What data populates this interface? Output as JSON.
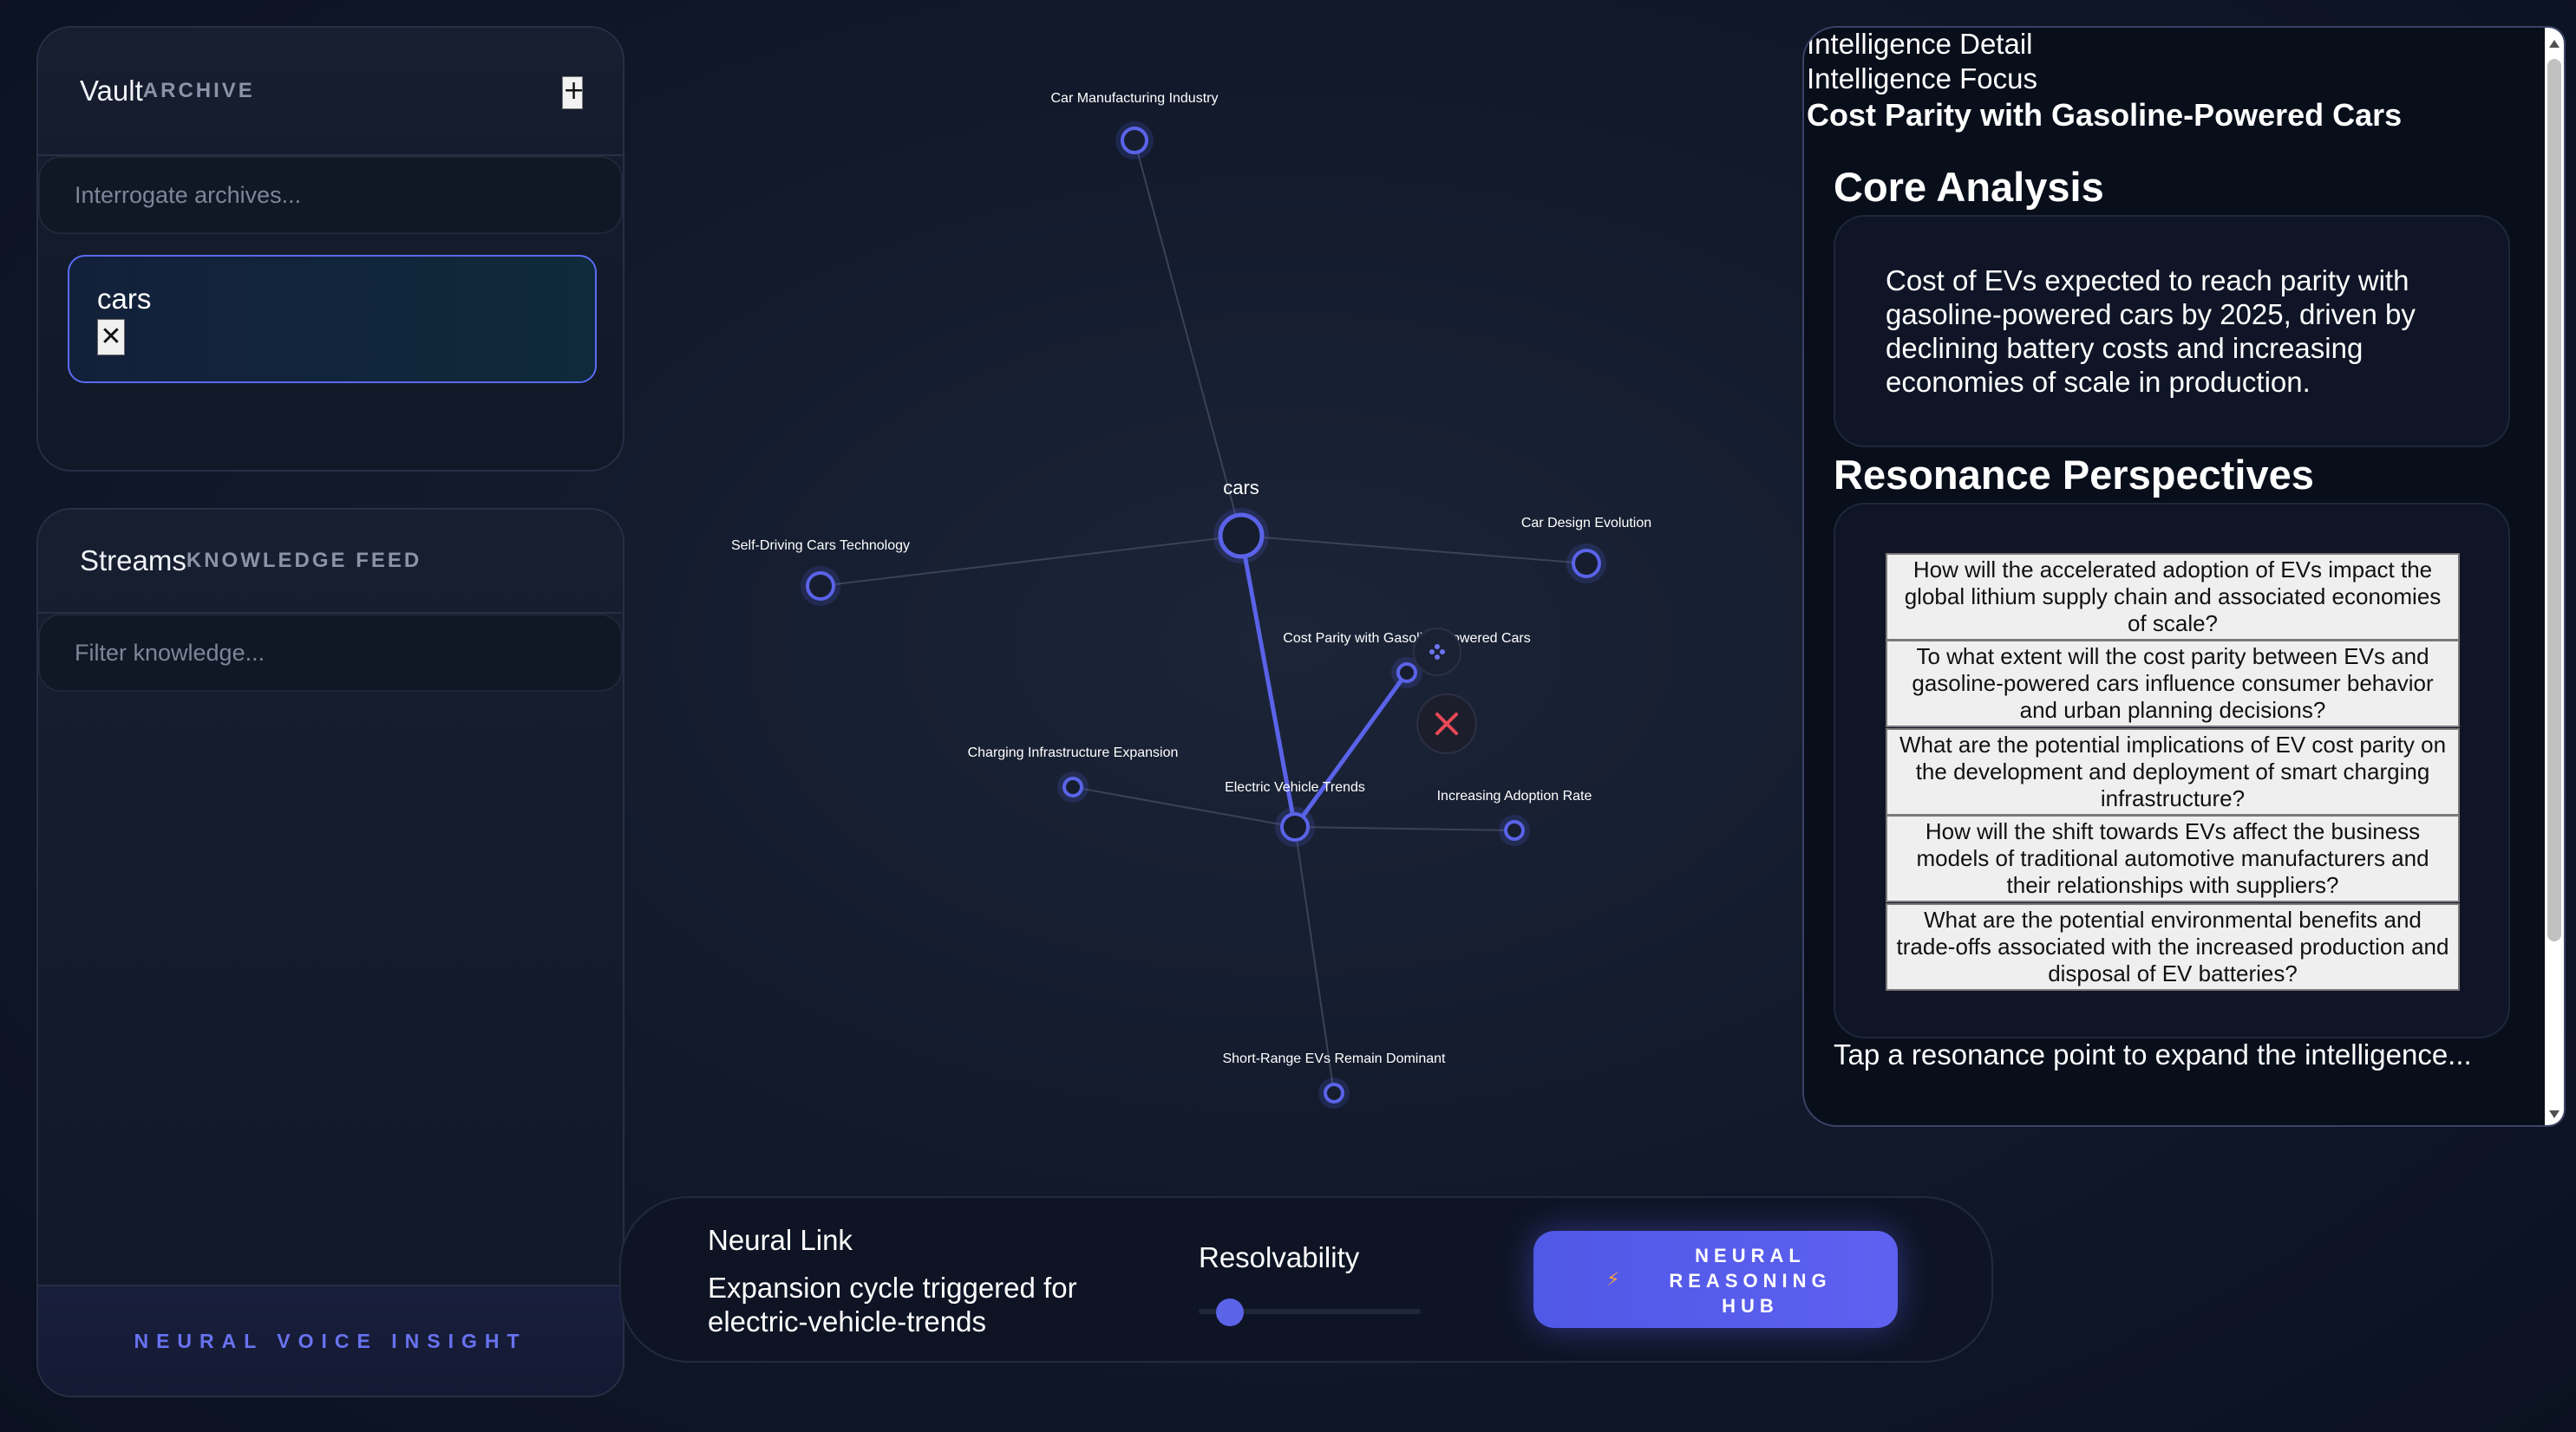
{
  "vault": {
    "title": "Vault",
    "subtitle": "ARCHIVE",
    "add_label": "+",
    "search_placeholder": "Interrogate archives...",
    "tag_label": "cars",
    "tag_remove_label": "✕"
  },
  "streams": {
    "title": "Streams",
    "subtitle": "KNOWLEDGE FEED",
    "filter_placeholder": "Filter knowledge...",
    "voice_label": "NEURAL VOICE INSIGHT"
  },
  "graph": {
    "nodes": [
      {
        "id": "car-manufacturing-industry",
        "label": "Car Manufacturing Industry"
      },
      {
        "id": "cars",
        "label": "cars"
      },
      {
        "id": "self-driving-cars-technology",
        "label": "Self-Driving Cars Technology"
      },
      {
        "id": "car-design-evolution",
        "label": "Car Design Evolution"
      },
      {
        "id": "cost-parity",
        "label": "Cost Parity with Gasoline-Powered Cars"
      },
      {
        "id": "charging-infrastructure-expansion",
        "label": "Charging Infrastructure Expansion"
      },
      {
        "id": "electric-vehicle-trends",
        "label": "Electric Vehicle Trends"
      },
      {
        "id": "increasing-adoption-rate",
        "label": "Increasing Adoption Rate"
      },
      {
        "id": "short-range-evs",
        "label": "Short-Range EVs Remain Dominant"
      }
    ],
    "edges": [
      [
        "cars",
        "car-manufacturing-industry"
      ],
      [
        "cars",
        "self-driving-cars-technology"
      ],
      [
        "cars",
        "car-design-evolution"
      ],
      [
        "cars",
        "electric-vehicle-trends"
      ],
      [
        "electric-vehicle-trends",
        "cost-parity"
      ],
      [
        "electric-vehicle-trends",
        "charging-infrastructure-expansion"
      ],
      [
        "electric-vehicle-trends",
        "increasing-adoption-rate"
      ],
      [
        "electric-vehicle-trends",
        "short-range-evs"
      ]
    ],
    "highlighted_edges": [
      [
        "cars",
        "electric-vehicle-trends"
      ],
      [
        "electric-vehicle-trends",
        "cost-parity"
      ]
    ],
    "colors": {
      "node": "#5a63e8",
      "edge": "#3a4256",
      "edge_active": "#5a63e8",
      "close": "#e84855"
    },
    "icons": {
      "move": "move-icon",
      "close": "close-icon"
    }
  },
  "detail": {
    "header_line1": "Intelligence Detail",
    "header_line2": "Intelligence Focus",
    "focus_title": "Cost Parity with Gasoline-Powered Cars",
    "core_title": "Core Analysis",
    "core_text": "Cost of EVs expected to reach parity with gasoline-powered cars by 2025, driven by declining battery costs and increasing economies of scale in production.",
    "resonance_title": "Resonance Perspectives",
    "questions": [
      "How will the accelerated adoption of EVs impact the global lithium supply chain and associated economies of scale?",
      "To what extent will the cost parity between EVs and gasoline-powered cars influence consumer behavior and urban planning decisions?",
      "What are the potential implications of EV cost parity on the development and deployment of smart charging infrastructure?",
      "How will the shift towards EVs affect the business models of traditional automotive manufacturers and their relationships with suppliers?",
      "What are the potential environmental benefits and trade-offs associated with the increased production and disposal of EV batteries?"
    ],
    "hint": "Tap a resonance point to expand the intelligence..."
  },
  "bottom": {
    "link_title": "Neural Link",
    "link_message": "Expansion cycle triggered for electric-vehicle-trends",
    "resolvability_label": "Resolvability",
    "resolvability_value": 0.1,
    "hub_label": "NEURAL REASONING HUB",
    "hub_icon": "bolt-icon"
  }
}
